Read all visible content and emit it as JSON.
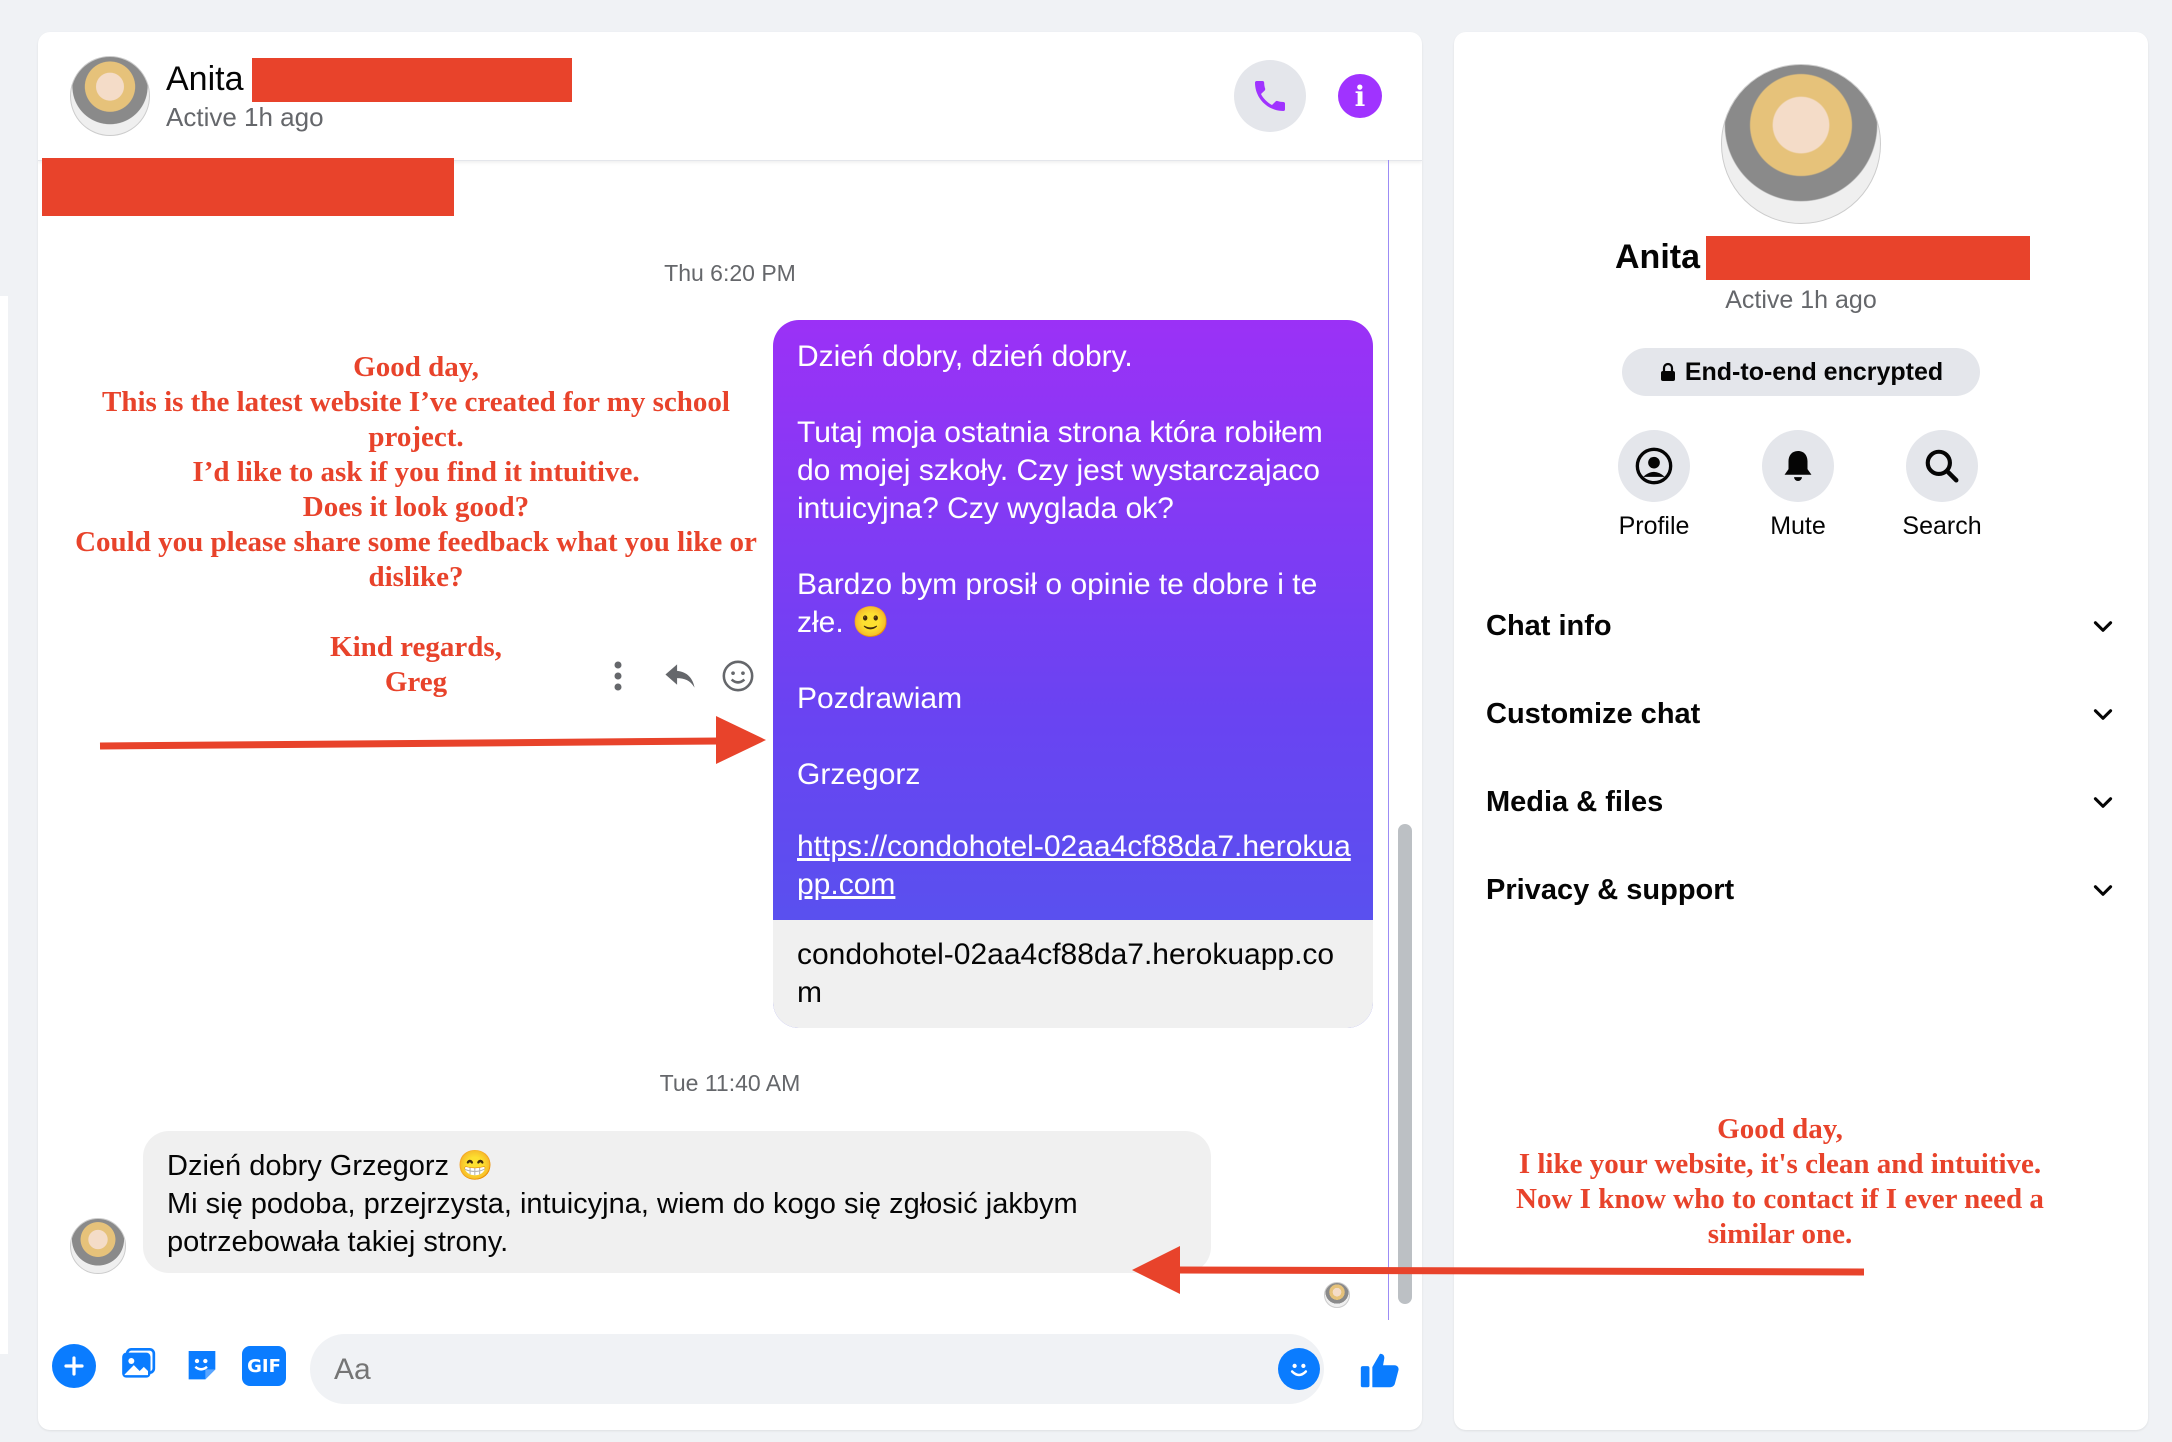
{
  "header": {
    "name": "Anita",
    "status": "Active 1h ago",
    "phone_icon": "phone-icon",
    "info_icon": "info-icon"
  },
  "thread": {
    "timestamp_1": "Thu 6:20 PM",
    "outgoing_text": "Dzień dobry, dzień dobry.\n\nTutaj moja ostatnia strona która robiłem do mojej szkoły. Czy jest wystarczajaco intuicyjna? Czy wyglada ok?\n\nBardzo bym prosił o opinie te dobre i te złe. 🙂\n\nPozdrawiam\n\nGrzegorz",
    "outgoing_link": "https://condohotel-02aa4cf88da7.herokuapp.com",
    "link_preview": "condohotel-02aa4cf88da7.herokuapp.com",
    "timestamp_2": "Tue 11:40 AM",
    "incoming_text": "Dzień dobry Grzegorz 😁\nMi się podoba, przejrzysta, intuicyjna, wiem do kogo się zgłosić jakbym potrzebowała takiej strony."
  },
  "annotations": {
    "left": "Good day,\nThis is the latest website I’ve created for my school project.\nI’d like to ask if you find it intuitive.\nDoes it look good?\nCould you please share some feedback what you like or dislike?\n\nKind regards,\nGreg",
    "right": "Good day,\nI like your website, it's clean and intuitive.\nNow I know who to contact if I ever need a similar one."
  },
  "composer": {
    "placeholder": "Aa"
  },
  "info_panel": {
    "name": "Anita",
    "status": "Active 1h ago",
    "encryption": "End-to-end encrypted",
    "actions": [
      "Profile",
      "Mute",
      "Search"
    ],
    "sections": [
      "Chat info",
      "Customize chat",
      "Media & files",
      "Privacy & support"
    ]
  },
  "colors": {
    "accent": "#a033ff",
    "messenger_blue": "#0a7cff",
    "annotation_red": "#e8432b"
  }
}
